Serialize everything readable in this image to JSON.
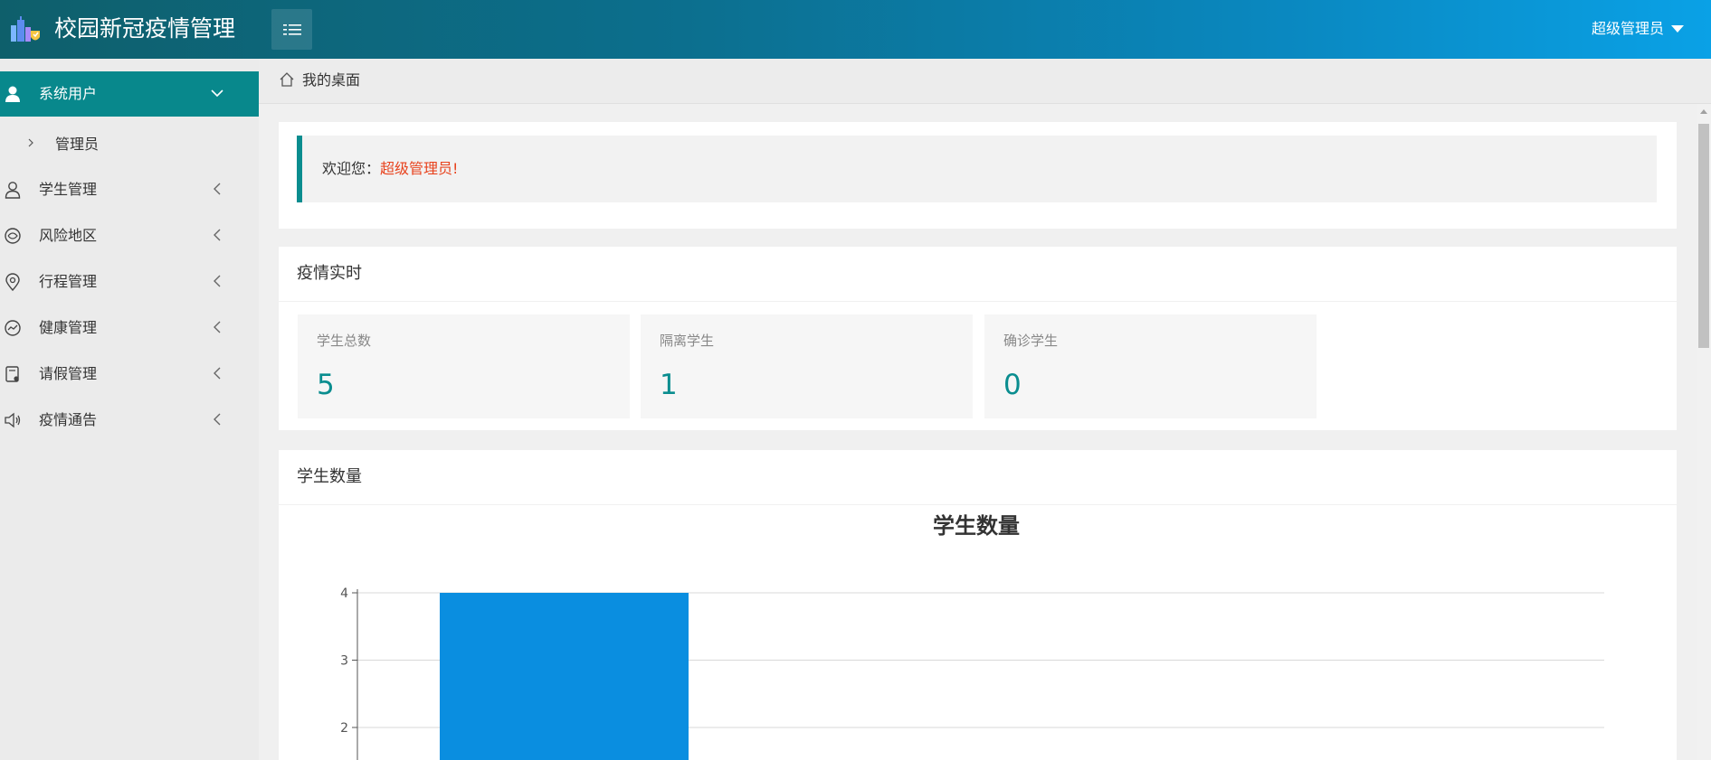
{
  "header": {
    "app_title": "校园新冠疫情管理",
    "logo_icon": "campus-building-logo-icon",
    "menu_toggle_icon": "hamburger-menu-icon",
    "user_name": "超级管理员",
    "brand_color": "#0a8d8f"
  },
  "sidebar": {
    "items": [
      {
        "label": "系统用户",
        "icon": "user-solid-icon",
        "expanded": true,
        "active": true
      },
      {
        "label": "学生管理",
        "icon": "user-outline-icon",
        "expanded": false
      },
      {
        "label": "风险地区",
        "icon": "risk-area-icon",
        "expanded": false
      },
      {
        "label": "行程管理",
        "icon": "location-pin-icon",
        "expanded": false
      },
      {
        "label": "健康管理",
        "icon": "health-chart-icon",
        "expanded": false
      },
      {
        "label": "请假管理",
        "icon": "leave-form-icon",
        "expanded": false
      },
      {
        "label": "疫情通告",
        "icon": "speaker-icon",
        "expanded": false
      }
    ],
    "sub_items": [
      {
        "label": "管理员"
      }
    ]
  },
  "breadcrumb": {
    "home_icon": "home-icon",
    "label": "我的桌面"
  },
  "welcome": {
    "prefix": "欢迎您：",
    "name": "超级管理员",
    "suffix": "!",
    "name_color": "#e8431e"
  },
  "stats": {
    "title": "疫情实时",
    "items": [
      {
        "label": "学生总数",
        "value": "5"
      },
      {
        "label": "隔离学生",
        "value": "1"
      },
      {
        "label": "确诊学生",
        "value": "0"
      }
    ]
  },
  "chart_section": {
    "title": "学生数量"
  },
  "chart_data": {
    "type": "bar",
    "title": "学生数量",
    "categories": [
      ""
    ],
    "values": [
      4
    ],
    "ylim": [
      0,
      4
    ],
    "yticks": [
      2,
      3,
      4
    ],
    "bar_color": "#0a8ee0",
    "grid": true
  }
}
